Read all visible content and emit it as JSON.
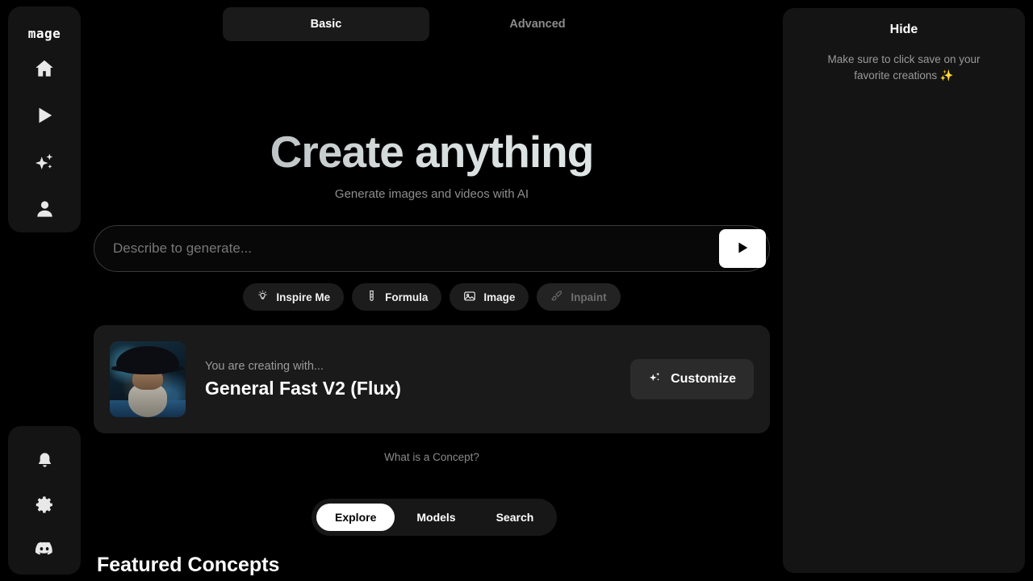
{
  "brand": {
    "name": "mage"
  },
  "sidebar": {
    "top_items": [
      {
        "name": "home-icon",
        "label": "Home"
      },
      {
        "name": "video-icon",
        "label": "Video"
      },
      {
        "name": "sparkles-icon",
        "label": "Create"
      },
      {
        "name": "account-icon",
        "label": "Account"
      }
    ],
    "bottom_items": [
      {
        "name": "bell-icon",
        "label": "Notifications"
      },
      {
        "name": "gear-icon",
        "label": "Settings"
      },
      {
        "name": "discord-icon",
        "label": "Discord"
      }
    ]
  },
  "tabs": {
    "basic": "Basic",
    "advanced": "Advanced",
    "active": "Basic"
  },
  "hero": {
    "title": "Create anything",
    "subtitle": "Generate images and videos with AI"
  },
  "prompt": {
    "placeholder": "Describe to generate...",
    "value": "",
    "submit_label": "Generate"
  },
  "chips": [
    {
      "icon": "lightbulb-icon",
      "label": "Inspire Me",
      "disabled": false
    },
    {
      "icon": "test-tube-icon",
      "label": "Formula",
      "disabled": false
    },
    {
      "icon": "image-icon",
      "label": "Image",
      "disabled": false
    },
    {
      "icon": "paintbrush-icon",
      "label": "Inpaint",
      "disabled": true
    }
  ],
  "model_card": {
    "kicker": "You are creating with...",
    "name": "General Fast V2 (Flux)",
    "customize_label": "Customize",
    "thumbnail_alt": "wizard-portrait"
  },
  "concept_link": "What is a Concept?",
  "segmented": {
    "items": [
      "Explore",
      "Models",
      "Search"
    ],
    "active": "Explore"
  },
  "featured_heading": "Featured Concepts",
  "right_panel": {
    "hide_label": "Hide",
    "note_line1": "Make sure to click save on your",
    "note_line2": "favorite creations",
    "note_emoji": "✨"
  },
  "colors": {
    "background": "#000000",
    "panel": "#141414",
    "card": "#1a1a1a",
    "chip": "#1c1c1c",
    "accent_white": "#ffffff",
    "muted_text": "#8e8e8e",
    "sparkle_gold": "#e7b94f"
  }
}
